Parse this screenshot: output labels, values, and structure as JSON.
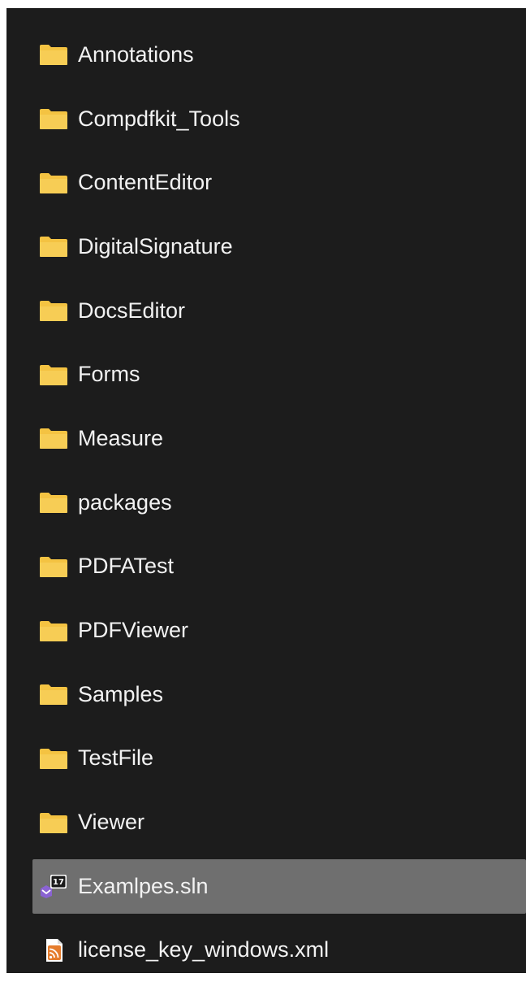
{
  "file_list": {
    "items": [
      {
        "name": "Annotations",
        "type": "folder",
        "icon": "folder-icon"
      },
      {
        "name": "Compdfkit_Tools",
        "type": "folder",
        "icon": "folder-icon"
      },
      {
        "name": "ContentEditor",
        "type": "folder",
        "icon": "folder-icon"
      },
      {
        "name": "DigitalSignature",
        "type": "folder",
        "icon": "folder-icon"
      },
      {
        "name": "DocsEditor",
        "type": "folder",
        "icon": "folder-icon"
      },
      {
        "name": "Forms",
        "type": "folder",
        "icon": "folder-icon"
      },
      {
        "name": "Measure",
        "type": "folder",
        "icon": "folder-icon"
      },
      {
        "name": "packages",
        "type": "folder",
        "icon": "folder-icon"
      },
      {
        "name": "PDFATest",
        "type": "folder",
        "icon": "folder-icon"
      },
      {
        "name": "PDFViewer",
        "type": "folder",
        "icon": "folder-icon"
      },
      {
        "name": "Samples",
        "type": "folder",
        "icon": "folder-icon"
      },
      {
        "name": "TestFile",
        "type": "folder",
        "icon": "folder-icon"
      },
      {
        "name": "Viewer",
        "type": "folder",
        "icon": "folder-icon"
      },
      {
        "name": "Examlpes.sln",
        "type": "solution",
        "icon": "visual-studio-solution-icon",
        "badge": "17",
        "selected": true
      },
      {
        "name": "license_key_windows.xml",
        "type": "xml",
        "icon": "xml-file-icon"
      }
    ]
  },
  "colors": {
    "background": "#1c1c1c",
    "selection": "#6f6f6f",
    "text": "#f2f2f2",
    "folder": "#f4c342",
    "xml_orange": "#e57c2c"
  }
}
